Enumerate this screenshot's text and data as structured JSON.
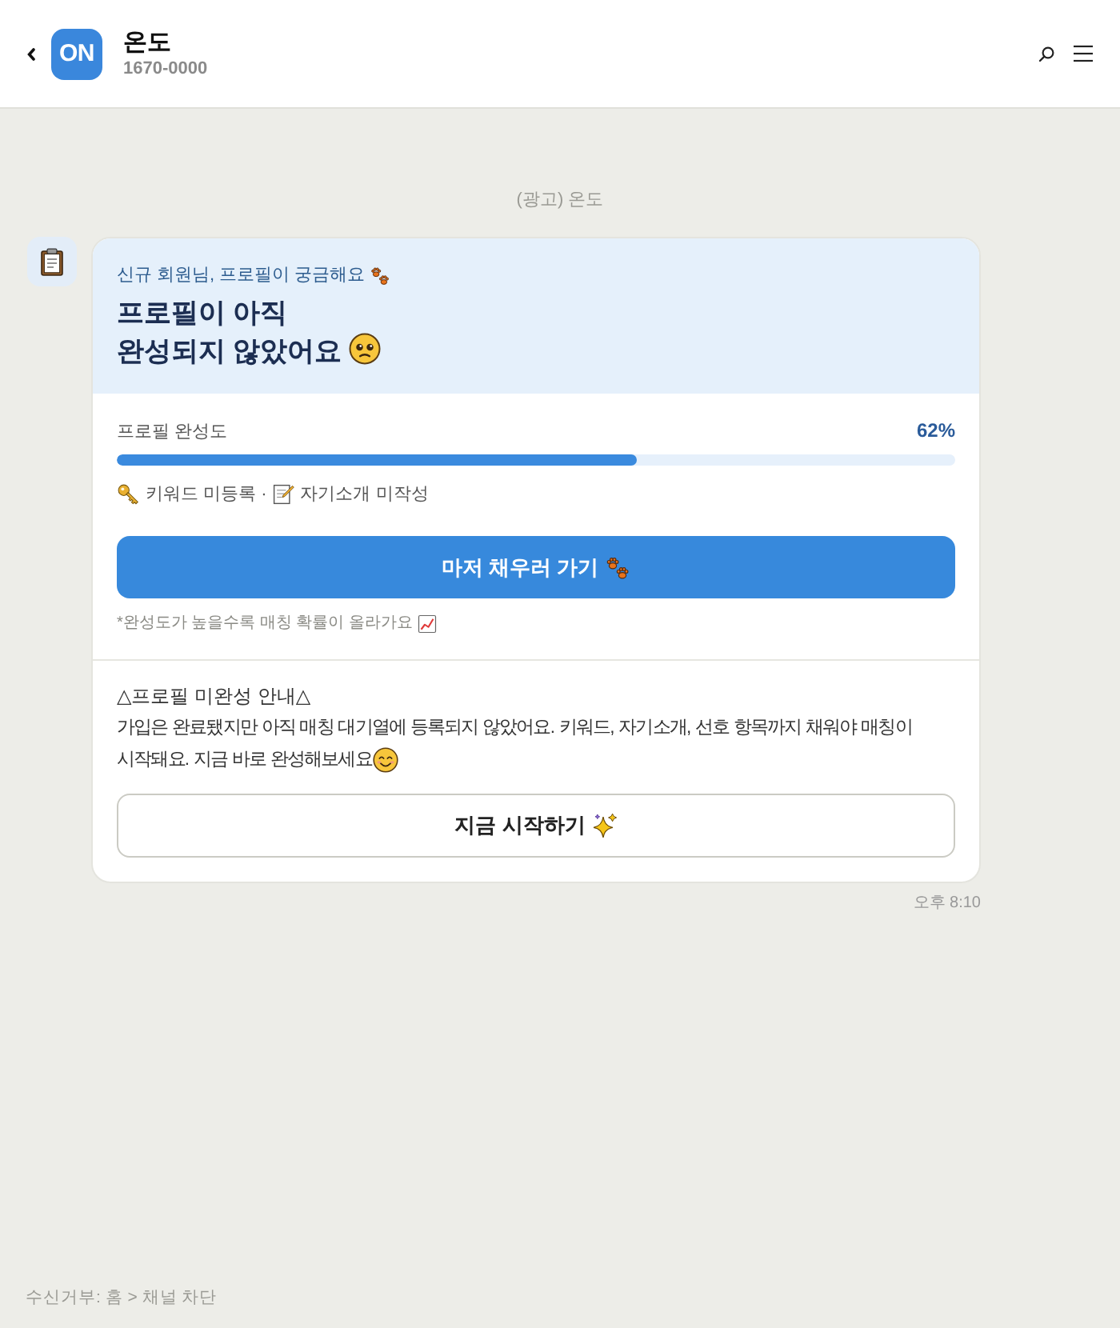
{
  "header": {
    "logo_text": "ON",
    "name": "온도",
    "phone": "1670-0000"
  },
  "ad_label": "(광고) 온도",
  "message": {
    "hero": {
      "eyebrow": "신규 회원님, 프로필이 궁금해요",
      "title": "프로필이 아직\n완성되지 않았어요"
    },
    "progress": {
      "label": "프로필 완성도",
      "reading": "62%",
      "level": 0.62
    },
    "missing": {
      "separator": "·",
      "items": [
        {
          "kind": "key",
          "label": "키워드 미등록"
        },
        {
          "kind": "memo",
          "label": "자기소개 미작성"
        }
      ]
    },
    "primary_button": {
      "label": "마저 채우러 가기"
    },
    "note": "*완성도가 높을수록 매칭 확률이 올라가요",
    "notice": {
      "title": "△프로필 미완성 안내△",
      "body_lines": [
        "가입은 완료됐지만 아직 매칭 대기열에 등록되지 않았어요. 키워드, 자기소개, 선호 항목까지 채워야 매칭이",
        "시작돼요. 지금 바로 완성해보세요"
      ]
    },
    "secondary_button": {
      "label": "지금 시작하기"
    },
    "time": "오후 8:10"
  },
  "footer": "수신거부: 홈 > 채널 차단"
}
